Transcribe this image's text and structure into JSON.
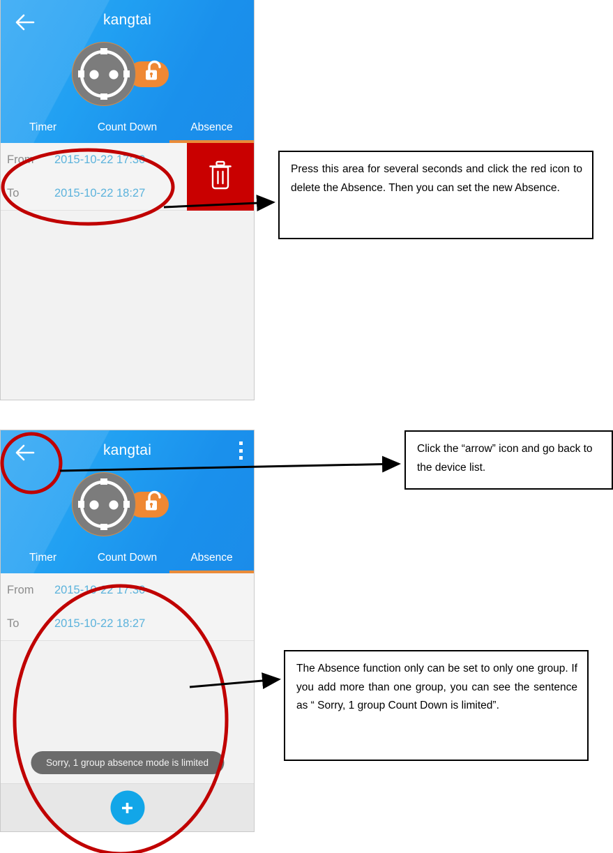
{
  "document": {
    "type": "annotated-mobile-app-manual-page"
  },
  "screens": [
    {
      "id": "screen-absence-delete",
      "header": {
        "title": "kangtai",
        "back_icon": "back-arrow-icon",
        "device_icon": "power-socket-icon",
        "lock_icon": "unlock-padlock-icon",
        "has_overflow_menu": false
      },
      "tabs": [
        {
          "label": "Timer",
          "active": false
        },
        {
          "label": "Count Down",
          "active": false
        },
        {
          "label": "Absence",
          "active": true
        }
      ],
      "absence_row": {
        "from_label": "From",
        "from_value": "2015-10-22 17:30",
        "to_label": "To",
        "to_value": "2015-10-22 18:27",
        "delete_icon": "trash-can-icon",
        "delete_panel_color": "#c90000"
      }
    },
    {
      "id": "screen-absence-limit",
      "header": {
        "title": "kangtai",
        "back_icon": "back-arrow-icon",
        "device_icon": "power-socket-icon",
        "lock_icon": "unlock-padlock-icon",
        "has_overflow_menu": true,
        "overflow_icon": "overflow-menu-icon"
      },
      "tabs": [
        {
          "label": "Timer",
          "active": false
        },
        {
          "label": "Count Down",
          "active": false
        },
        {
          "label": "Absence",
          "active": true
        }
      ],
      "absence_row": {
        "from_label": "From",
        "from_value": "2015-10-22 17:30",
        "to_label": "To",
        "to_value": "2015-10-22 18:27"
      },
      "toast": "Sorry, 1 group absence mode is limited",
      "fab": {
        "icon": "plus-icon",
        "color": "#12a6e8"
      }
    }
  ],
  "annotations": [
    {
      "id": "callout-1",
      "text": "Press this area for several seconds and click the red icon to delete the Absence. Then you can set the new Absence."
    },
    {
      "id": "callout-2",
      "text": "Click the “arrow” icon and go back to the device list."
    },
    {
      "id": "callout-3",
      "text": "The Absence function only can be set to only one group. If you add more than one group, you can see the sentence as “ Sorry, 1 group Count Down is limited”."
    }
  ],
  "colors": {
    "header_blue": "#21a0f2",
    "tab_indicator_orange": "#e98b39",
    "delete_red": "#c90000",
    "annotation_red": "#c00000",
    "value_blue": "#5cb3dc",
    "label_gray": "#8c8c8c",
    "fab_blue": "#12a6e8",
    "toast_gray": "#6b6b6b"
  }
}
